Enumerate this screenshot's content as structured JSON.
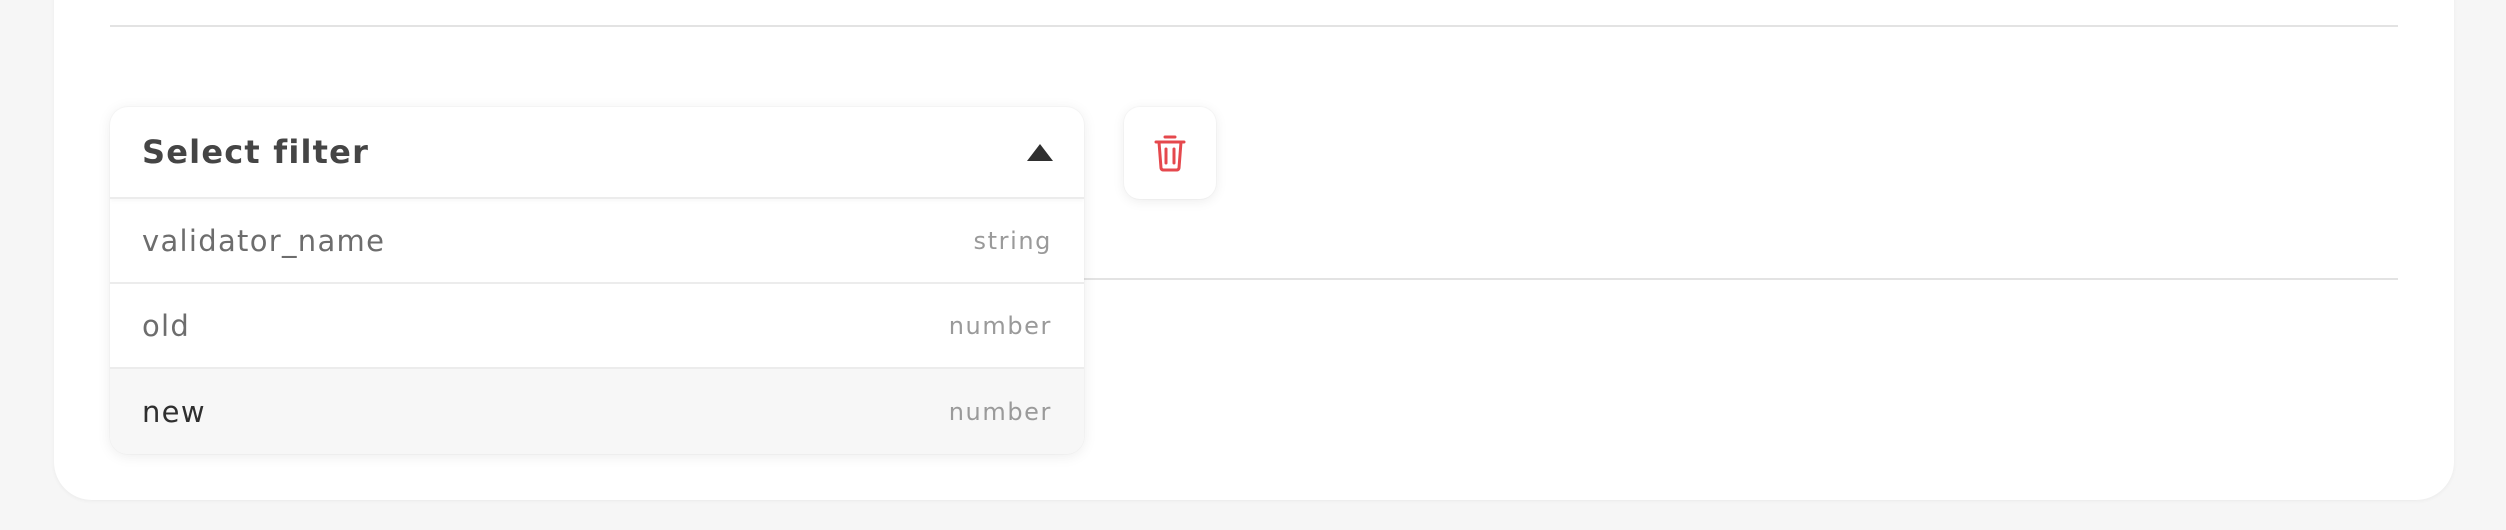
{
  "filter_dropdown": {
    "title": "Select filter",
    "options": [
      {
        "name": "validator_name",
        "type": "string"
      },
      {
        "name": "old",
        "type": "number"
      },
      {
        "name": "new",
        "type": "number"
      }
    ]
  },
  "delete_button": {
    "icon": "trash-icon",
    "color": "#e5484d"
  },
  "colors": {
    "background": "#f6f6f6",
    "card": "#ffffff",
    "danger": "#e5484d"
  }
}
